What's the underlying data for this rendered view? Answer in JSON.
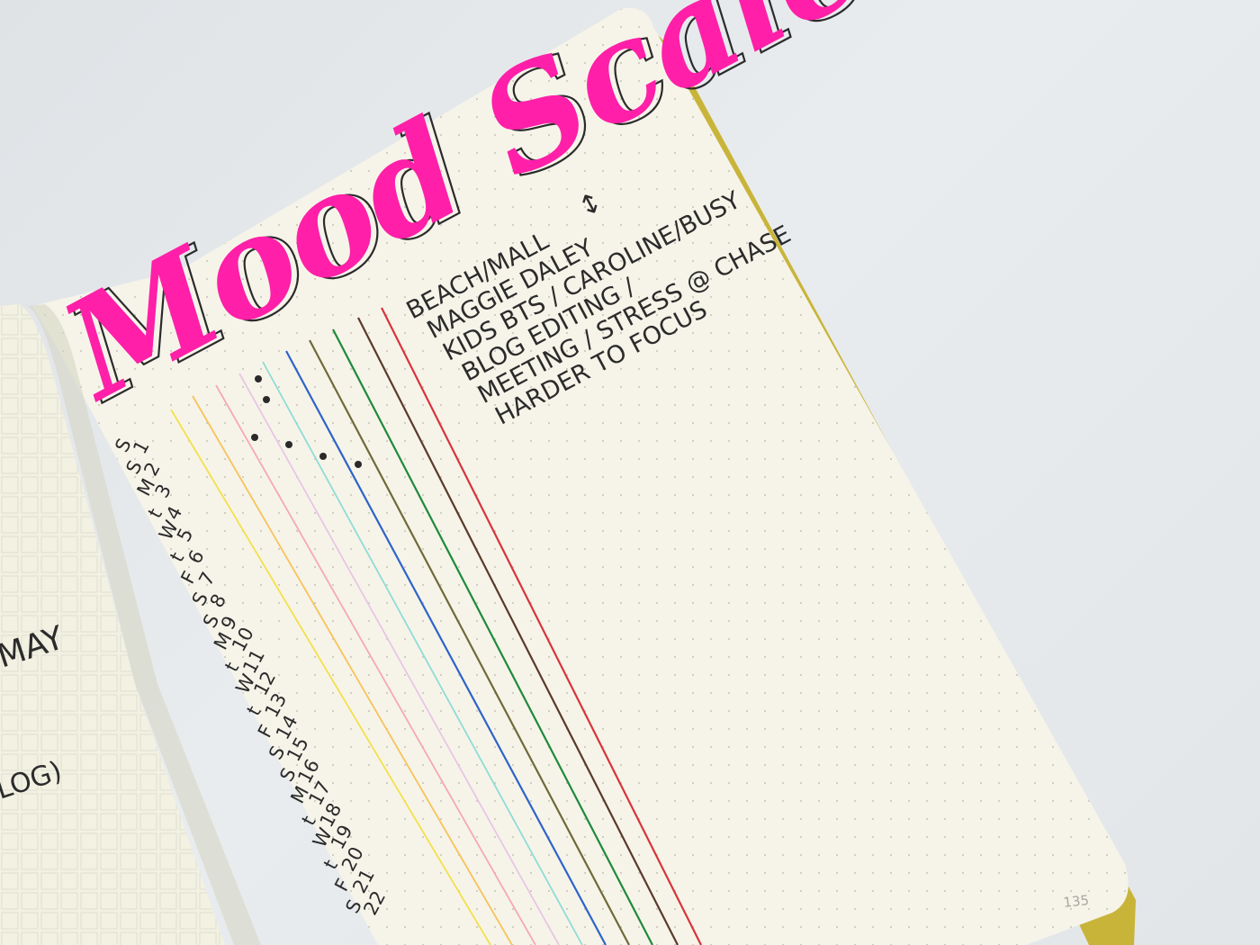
{
  "journal": {
    "title": "Mood Scale",
    "key_lines": [
      "BEACH/MALL",
      "MAGGIE DALEY",
      "KIDS BTS / CAROLINE/BUSY",
      "BLOG EDITING /",
      "MEETING / STRESS @ CHASE",
      "HARDER TO FOCUS"
    ],
    "key_arrow": "↕",
    "days": [
      {
        "letter": "S",
        "num": "1"
      },
      {
        "letter": "S",
        "num": "2"
      },
      {
        "letter": "M",
        "num": "3"
      },
      {
        "letter": "t",
        "num": "4"
      },
      {
        "letter": "W",
        "num": "5"
      },
      {
        "letter": "t",
        "num": "6"
      },
      {
        "letter": "F",
        "num": "7"
      },
      {
        "letter": "S",
        "num": "8"
      },
      {
        "letter": "S",
        "num": "9"
      },
      {
        "letter": "M",
        "num": "10"
      },
      {
        "letter": "t",
        "num": "11"
      },
      {
        "letter": "W",
        "num": "12"
      },
      {
        "letter": "t",
        "num": "13"
      },
      {
        "letter": "F",
        "num": "14"
      },
      {
        "letter": "S",
        "num": "15"
      },
      {
        "letter": "S",
        "num": "16"
      },
      {
        "letter": "M",
        "num": "17"
      },
      {
        "letter": "t",
        "num": "18"
      },
      {
        "letter": "W",
        "num": "19"
      },
      {
        "letter": "t",
        "num": "20"
      },
      {
        "letter": "F",
        "num": "21"
      },
      {
        "letter": "S",
        "num": "22"
      }
    ],
    "scale_colors": [
      "#f4e04a",
      "#f7c35a",
      "#f5a8b8",
      "#e8c6e6",
      "#8fdcd8",
      "#2f63c9",
      "#6f6a3a",
      "#1f8a3a",
      "#5a3a2a",
      "#d8343c"
    ],
    "page_number": "135",
    "left_page_texts": [
      "MAY",
      "LOG)"
    ],
    "colors": {
      "title_pink": "#ff1fa8",
      "paper": "#f6f4e9",
      "ink": "#2b2b2b",
      "cover_edge": "#c9b43a"
    }
  }
}
